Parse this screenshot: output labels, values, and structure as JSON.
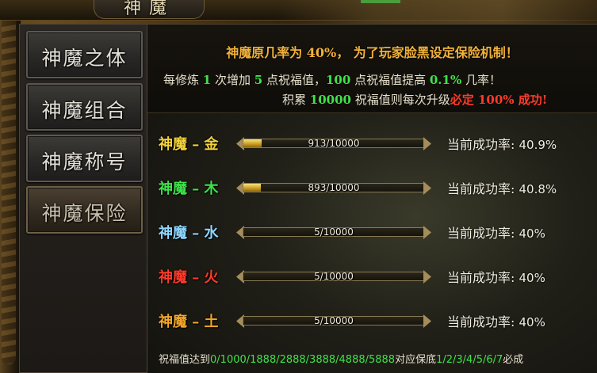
{
  "window": {
    "title": "神魔"
  },
  "tabs": [
    {
      "label": "神魔之体",
      "active": false
    },
    {
      "label": "神魔组合",
      "active": false
    },
    {
      "label": "神魔称号",
      "active": false
    },
    {
      "label": "神魔保险",
      "active": true
    }
  ],
  "info": {
    "line1": "神魔原几率为 40%， 为了玩家脸黑设定保险机制！",
    "line2": {
      "p1": "每修炼 ",
      "n1": "1",
      "p2": " 次增加 ",
      "n2": "5",
      "p3": " 点祝福值，",
      "n3": "100",
      "p4": " 点祝福值提高 ",
      "n4": "0.1%",
      "p5": " 几率！"
    },
    "line3": {
      "p1": "积累 ",
      "n1": "10000",
      "p2": " 祝福值则每次升级",
      "r1": "必定 100% 成功!"
    }
  },
  "rows": [
    {
      "name": "神魔 – 金",
      "color": "#f4d23c",
      "blessing": "913/10000",
      "fill_ratio": 0.0913,
      "rate_label": "当前成功率:",
      "rate_value": "40.9%"
    },
    {
      "name": "神魔 – 木",
      "color": "#3fe24a",
      "blessing": "893/10000",
      "fill_ratio": 0.0893,
      "rate_label": "当前成功率:",
      "rate_value": "40.8%"
    },
    {
      "name": "神魔 – 水",
      "color": "#8fd6ff",
      "blessing": "5/10000",
      "fill_ratio": 0.0005,
      "rate_label": "当前成功率:",
      "rate_value": "40%"
    },
    {
      "name": "神魔 – 火",
      "color": "#ff3a2a",
      "blessing": "5/10000",
      "fill_ratio": 0.0005,
      "rate_label": "当前成功率:",
      "rate_value": "40%"
    },
    {
      "name": "神魔 – 土",
      "color": "#f2a62a",
      "blessing": "5/10000",
      "fill_ratio": 0.0005,
      "rate_label": "当前成功率:",
      "rate_value": "40%"
    }
  ],
  "footer": {
    "p1": "祝福值达到",
    "thresholds": "0/1000/1888/2888/3888/4888/5888",
    "p2": "对应保底",
    "levels": "1/2/3/4/5/6/7",
    "p3": "必成"
  }
}
